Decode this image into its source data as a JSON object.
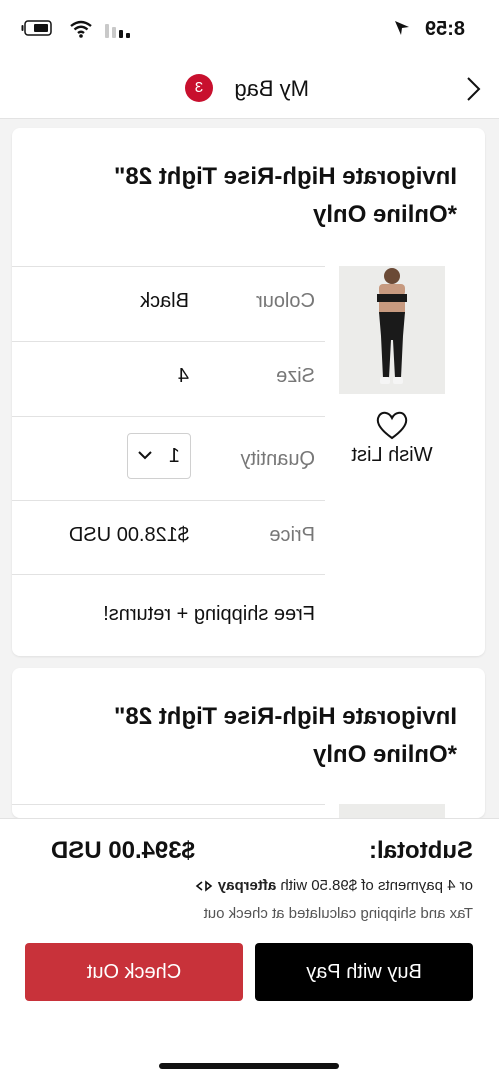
{
  "status_bar": {
    "time": "8:59"
  },
  "header": {
    "title": "My Bag",
    "bag_count": "3"
  },
  "items": [
    {
      "title": "Invigorate High-Rise Tight 28\" *Online Only",
      "colour_label": "Colour",
      "colour_value": "Black",
      "size_label": "Size",
      "size_value": "4",
      "quantity_label": "Quantity",
      "quantity_value": "1",
      "price_label": "Price",
      "price_value": "$128.00 USD",
      "shipping_note": "Free shipping + returns!",
      "wish_list_label": "Wish List"
    },
    {
      "title": "Invigorate High-Rise Tight 28\" *Online Only"
    }
  ],
  "summary": {
    "subtotal_label": "Subtotal:",
    "subtotal_value": "$394.00 USD",
    "afterpay_text": "or 4 payments of $98.50 with",
    "afterpay_brand": "afterpay",
    "tax_note": "Tax and shipping calculated at check out",
    "checkout_label": "Check Out",
    "applepay_label": "Buy with  Pay"
  },
  "colors": {
    "brand_red": "#c8102e",
    "button_red": "#c8323a",
    "black": "#000000"
  }
}
